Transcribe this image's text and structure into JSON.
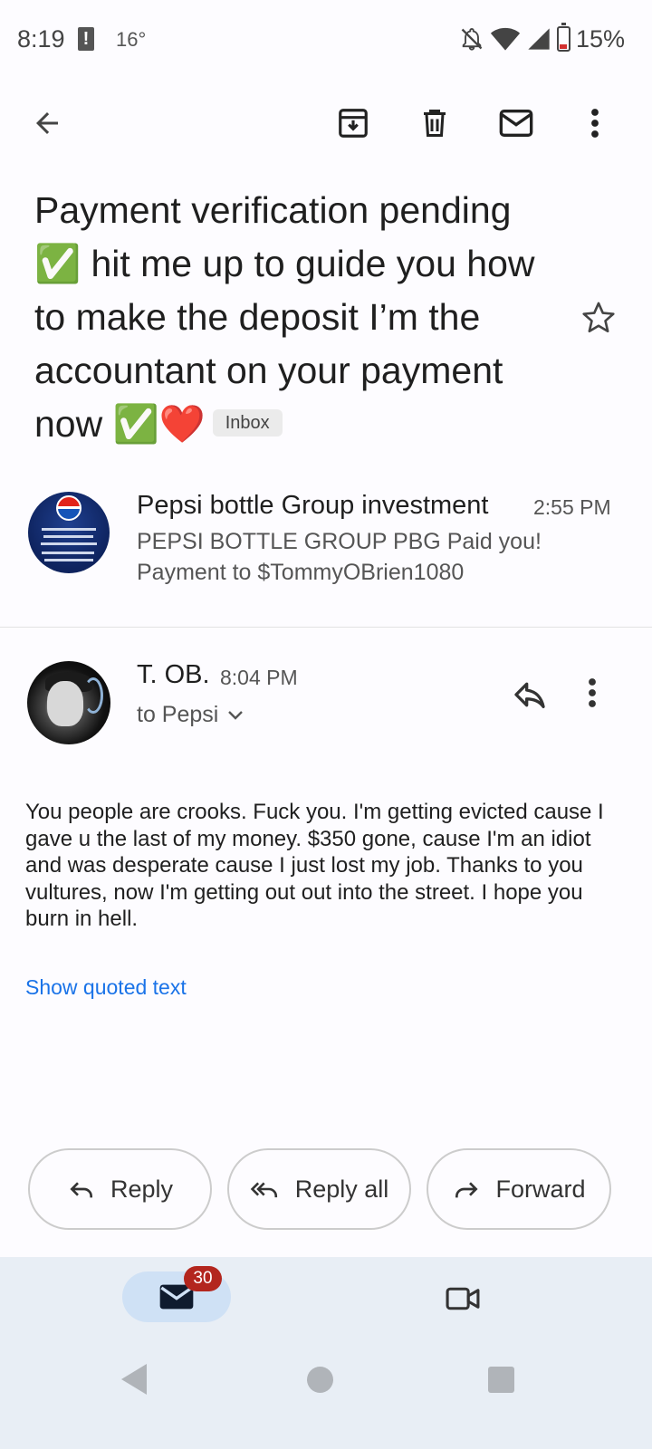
{
  "status_bar": {
    "time": "8:19",
    "temperature": "16°",
    "battery": "15%",
    "icons": [
      "alert-icon",
      "mute-icon",
      "wifi-icon",
      "signal-icon",
      "battery-icon"
    ]
  },
  "toolbar": {
    "icons": [
      "back-arrow-icon",
      "archive-icon",
      "delete-icon",
      "mark-unread-icon",
      "more-vert-icon"
    ]
  },
  "email": {
    "subject_lines": [
      "Payment verification pending",
      "✅ hit me up to guide you how",
      "to make the deposit I’m the",
      "accountant on your payment",
      "now ✅❤️"
    ],
    "label": "Inbox",
    "starred": false
  },
  "messages": [
    {
      "sender": "Pepsi bottle Group investment",
      "time": "2:55 PM",
      "snippet": "PEPSI BOTTLE GROUP PBG Paid you! Payment to $TommyOBrien1080"
    },
    {
      "sender": "T. OB.",
      "time": "8:04 PM",
      "recipient": "to Pepsi",
      "body": "You people are crooks.  Fuck you.  I'm getting evicted cause I gave u the last of my money.  $350 gone, cause I'm an idiot and was desperate cause I just lost my job.  Thanks to you vultures, now I'm getting out out into the street.  I hope you burn in hell.",
      "show_quoted": "Show quoted text"
    }
  ],
  "actions": {
    "reply": "Reply",
    "reply_all": "Reply all",
    "forward": "Forward"
  },
  "bottom_nav": {
    "mail_badge": "30",
    "icons": [
      "mail-icon",
      "video-icon"
    ]
  },
  "colors": {
    "link": "#1a73e8",
    "badge": "#b3261e",
    "nav_background": "#e8eef5",
    "nav_active": "#cfe1f5"
  }
}
